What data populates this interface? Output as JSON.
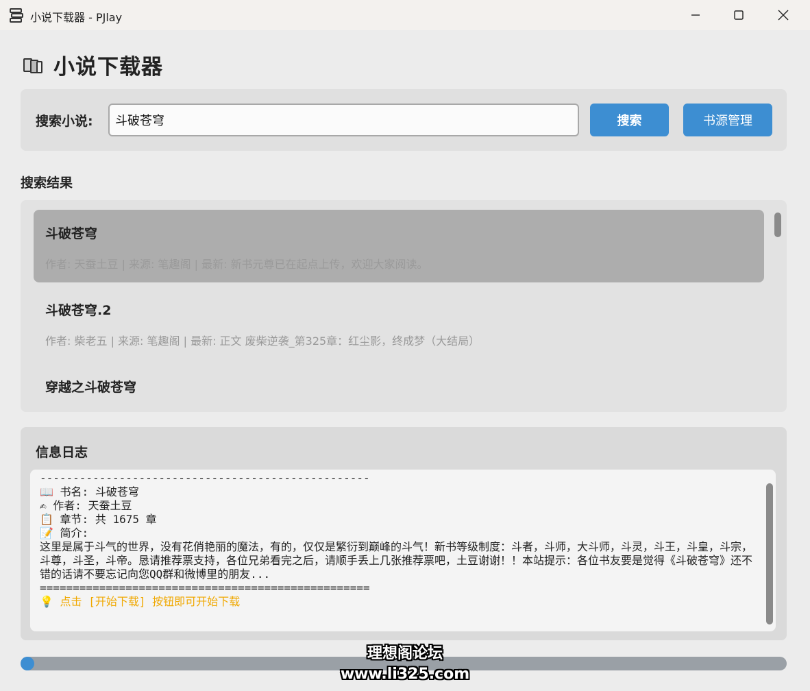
{
  "window": {
    "title": "小说下载器 - PJlay",
    "icon": "app-logo-icon",
    "controls": [
      "minimize-icon",
      "maximize-icon",
      "close-icon"
    ]
  },
  "header": {
    "icon": "books-icon",
    "title": "小说下载器"
  },
  "search": {
    "label": "搜索小说:",
    "value": "斗破苍穹",
    "search_button": "搜索",
    "sources_button": "书源管理"
  },
  "results": {
    "title": "搜索结果",
    "items": [
      {
        "title": "斗破苍穹",
        "meta": "作者: 天蚕土豆 | 来源: 笔趣阁 | 最新: 新书元尊已在起点上传，欢迎大家阅读。",
        "selected": true
      },
      {
        "title": "斗破苍穹.2",
        "meta": "作者: 柴老五 | 来源: 笔趣阁 | 最新: 正文 废柴逆袭_第325章：红尘影，终成梦（大结局）",
        "selected": false
      },
      {
        "title": "穿越之斗破苍穹",
        "meta": "",
        "selected": false
      }
    ]
  },
  "log": {
    "title": "信息日志",
    "lines": [
      "--------------------------------------------------",
      "📖 书名: 斗破苍穹",
      "✍ 作者: 天蚕土豆",
      "📋 章节: 共 1675 章",
      "📝 简介:",
      "这里是属于斗气的世界，没有花俏艳丽的魔法，有的，仅仅是繁衍到巅峰的斗气！新书等级制度：斗者，斗师，大斗师，斗灵，斗王，斗皇，斗宗，斗尊，斗圣，斗帝。恳请推荐票支持，各位兄弟看完之后，请顺手丢上几张推荐票吧，土豆谢谢！！本站提示：各位书友要是觉得《斗破苍穹》还不错的话请不要忘记向您QQ群和微博里的朋友...",
      "==================================================",
      "💡 点击 [开始下载] 按钮即可开始下载"
    ]
  },
  "progress": {
    "value": 0
  },
  "watermark": {
    "line1": "理想阁论坛",
    "line2": "www.li325.com"
  },
  "colors": {
    "accent": "#3d8ed2",
    "hint": "#f0a800",
    "selected_row": "#adadad"
  }
}
